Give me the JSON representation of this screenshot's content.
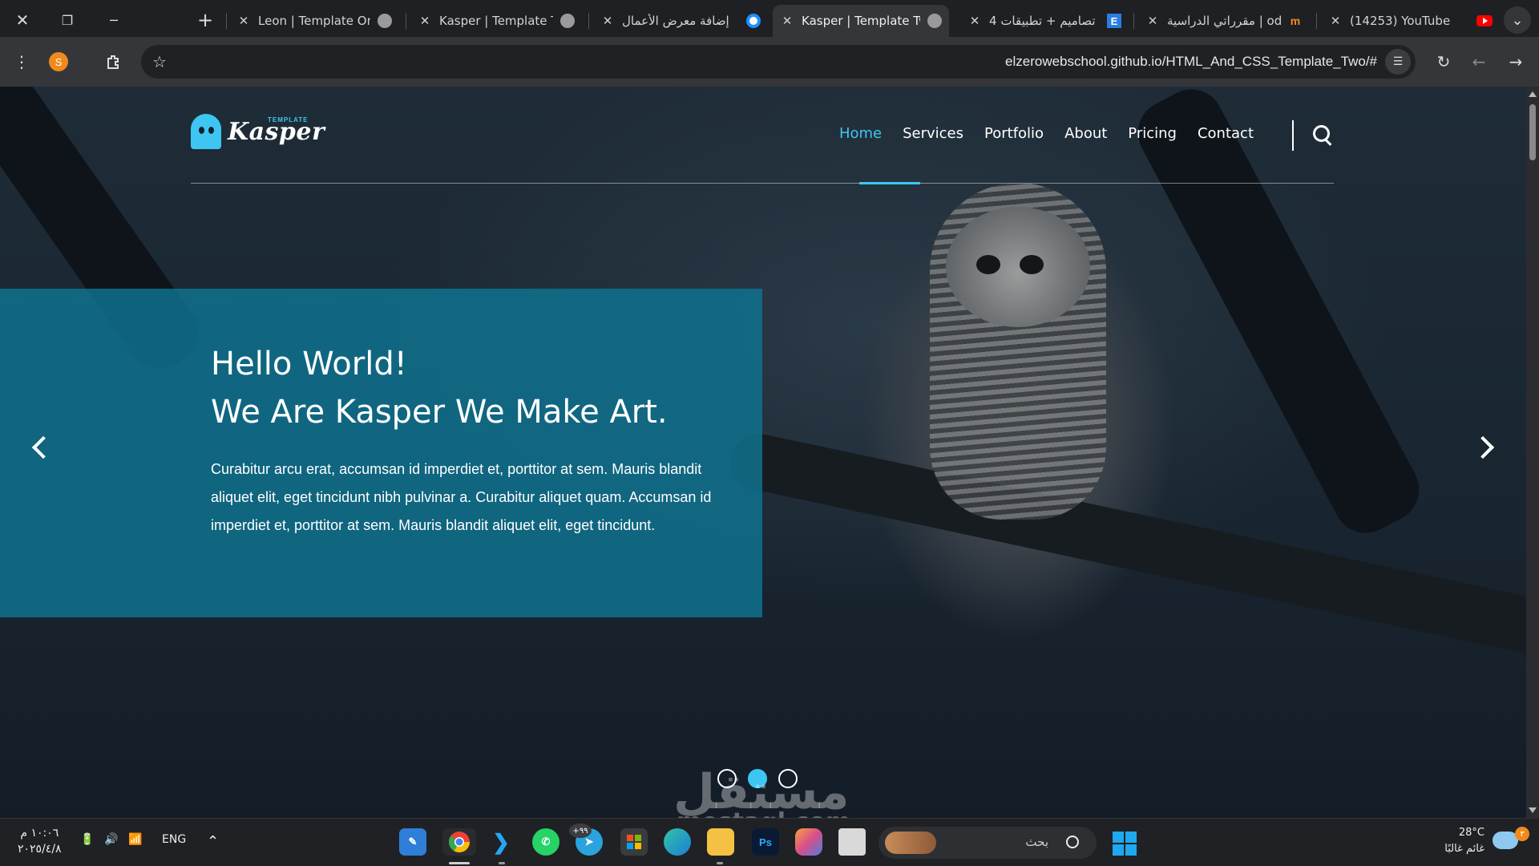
{
  "window_controls": {
    "close": "✕",
    "restore": "❐",
    "minimize": "─"
  },
  "tabs": [
    {
      "title": "Leon | Template One",
      "favicon": "globe-icon",
      "active": false
    },
    {
      "title": "Kasper | Template Tw",
      "favicon": "globe-icon",
      "active": false
    },
    {
      "title": "إضافة معرض الأعمال",
      "favicon": "ring-icon",
      "active": false
    },
    {
      "title": "Kasper | Template Tw",
      "favicon": "globe-icon",
      "active": true
    },
    {
      "title": "4 تصاميم + تطبيقات",
      "favicon": "e-icon",
      "active": false
    },
    {
      "title": "مقرراتي الدراسية | odle",
      "favicon": "moodle-icon",
      "active": false
    },
    {
      "title": "(14253) YouTube",
      "favicon": "youtube-icon",
      "active": false
    }
  ],
  "new_tab": "+",
  "tab_search": "⌄",
  "favicons": {
    "e": "E",
    "moodle": "m"
  },
  "toolbar": {
    "menu_icon": "⋮",
    "profile_initial": "S",
    "url": "elzerowebschool.github.io/HTML_And_CSS_Template_Two/#"
  },
  "site": {
    "logo_small": "TEMPLATE",
    "logo_big": "Kasper",
    "menu": [
      "Home",
      "Services",
      "Portfolio",
      "About",
      "Pricing",
      "Contact"
    ],
    "active_menu": "Home",
    "hero_line1": "Hello World!",
    "hero_line2": "We Are Kasper We Make Art.",
    "hero_text": "Curabitur arcu erat, accumsan id imperdiet et, porttitor at sem. Mauris blandit aliquet elit, eget tincidunt nibh pulvinar a. Curabitur aliquet quam. Accumsan id imperdiet et, porttitor at sem. Mauris blandit aliquet elit, eget tincidunt.",
    "slides": 3,
    "current_slide": 2,
    "accent": "#3ec6f2"
  },
  "watermark": {
    "main": "مستقل",
    "sub": "mostaql.com"
  },
  "taskbar": {
    "time": "١٠:٠٦ م",
    "date": "٢٠٢٥/٤/٨",
    "lang": "ENG",
    "tray_chevron": "⌃",
    "search_placeholder": "بحث",
    "telegram_badge": "+٩٩",
    "weather_temp": "28°C",
    "weather_text": "غائم غالبًا",
    "notification_count": "٣",
    "apps": [
      "Paint",
      "Chrome",
      "VS Code",
      "WhatsApp",
      "Telegram",
      "Store",
      "Edge",
      "Files",
      "Photoshop",
      "Copilot",
      "Explorer"
    ]
  }
}
